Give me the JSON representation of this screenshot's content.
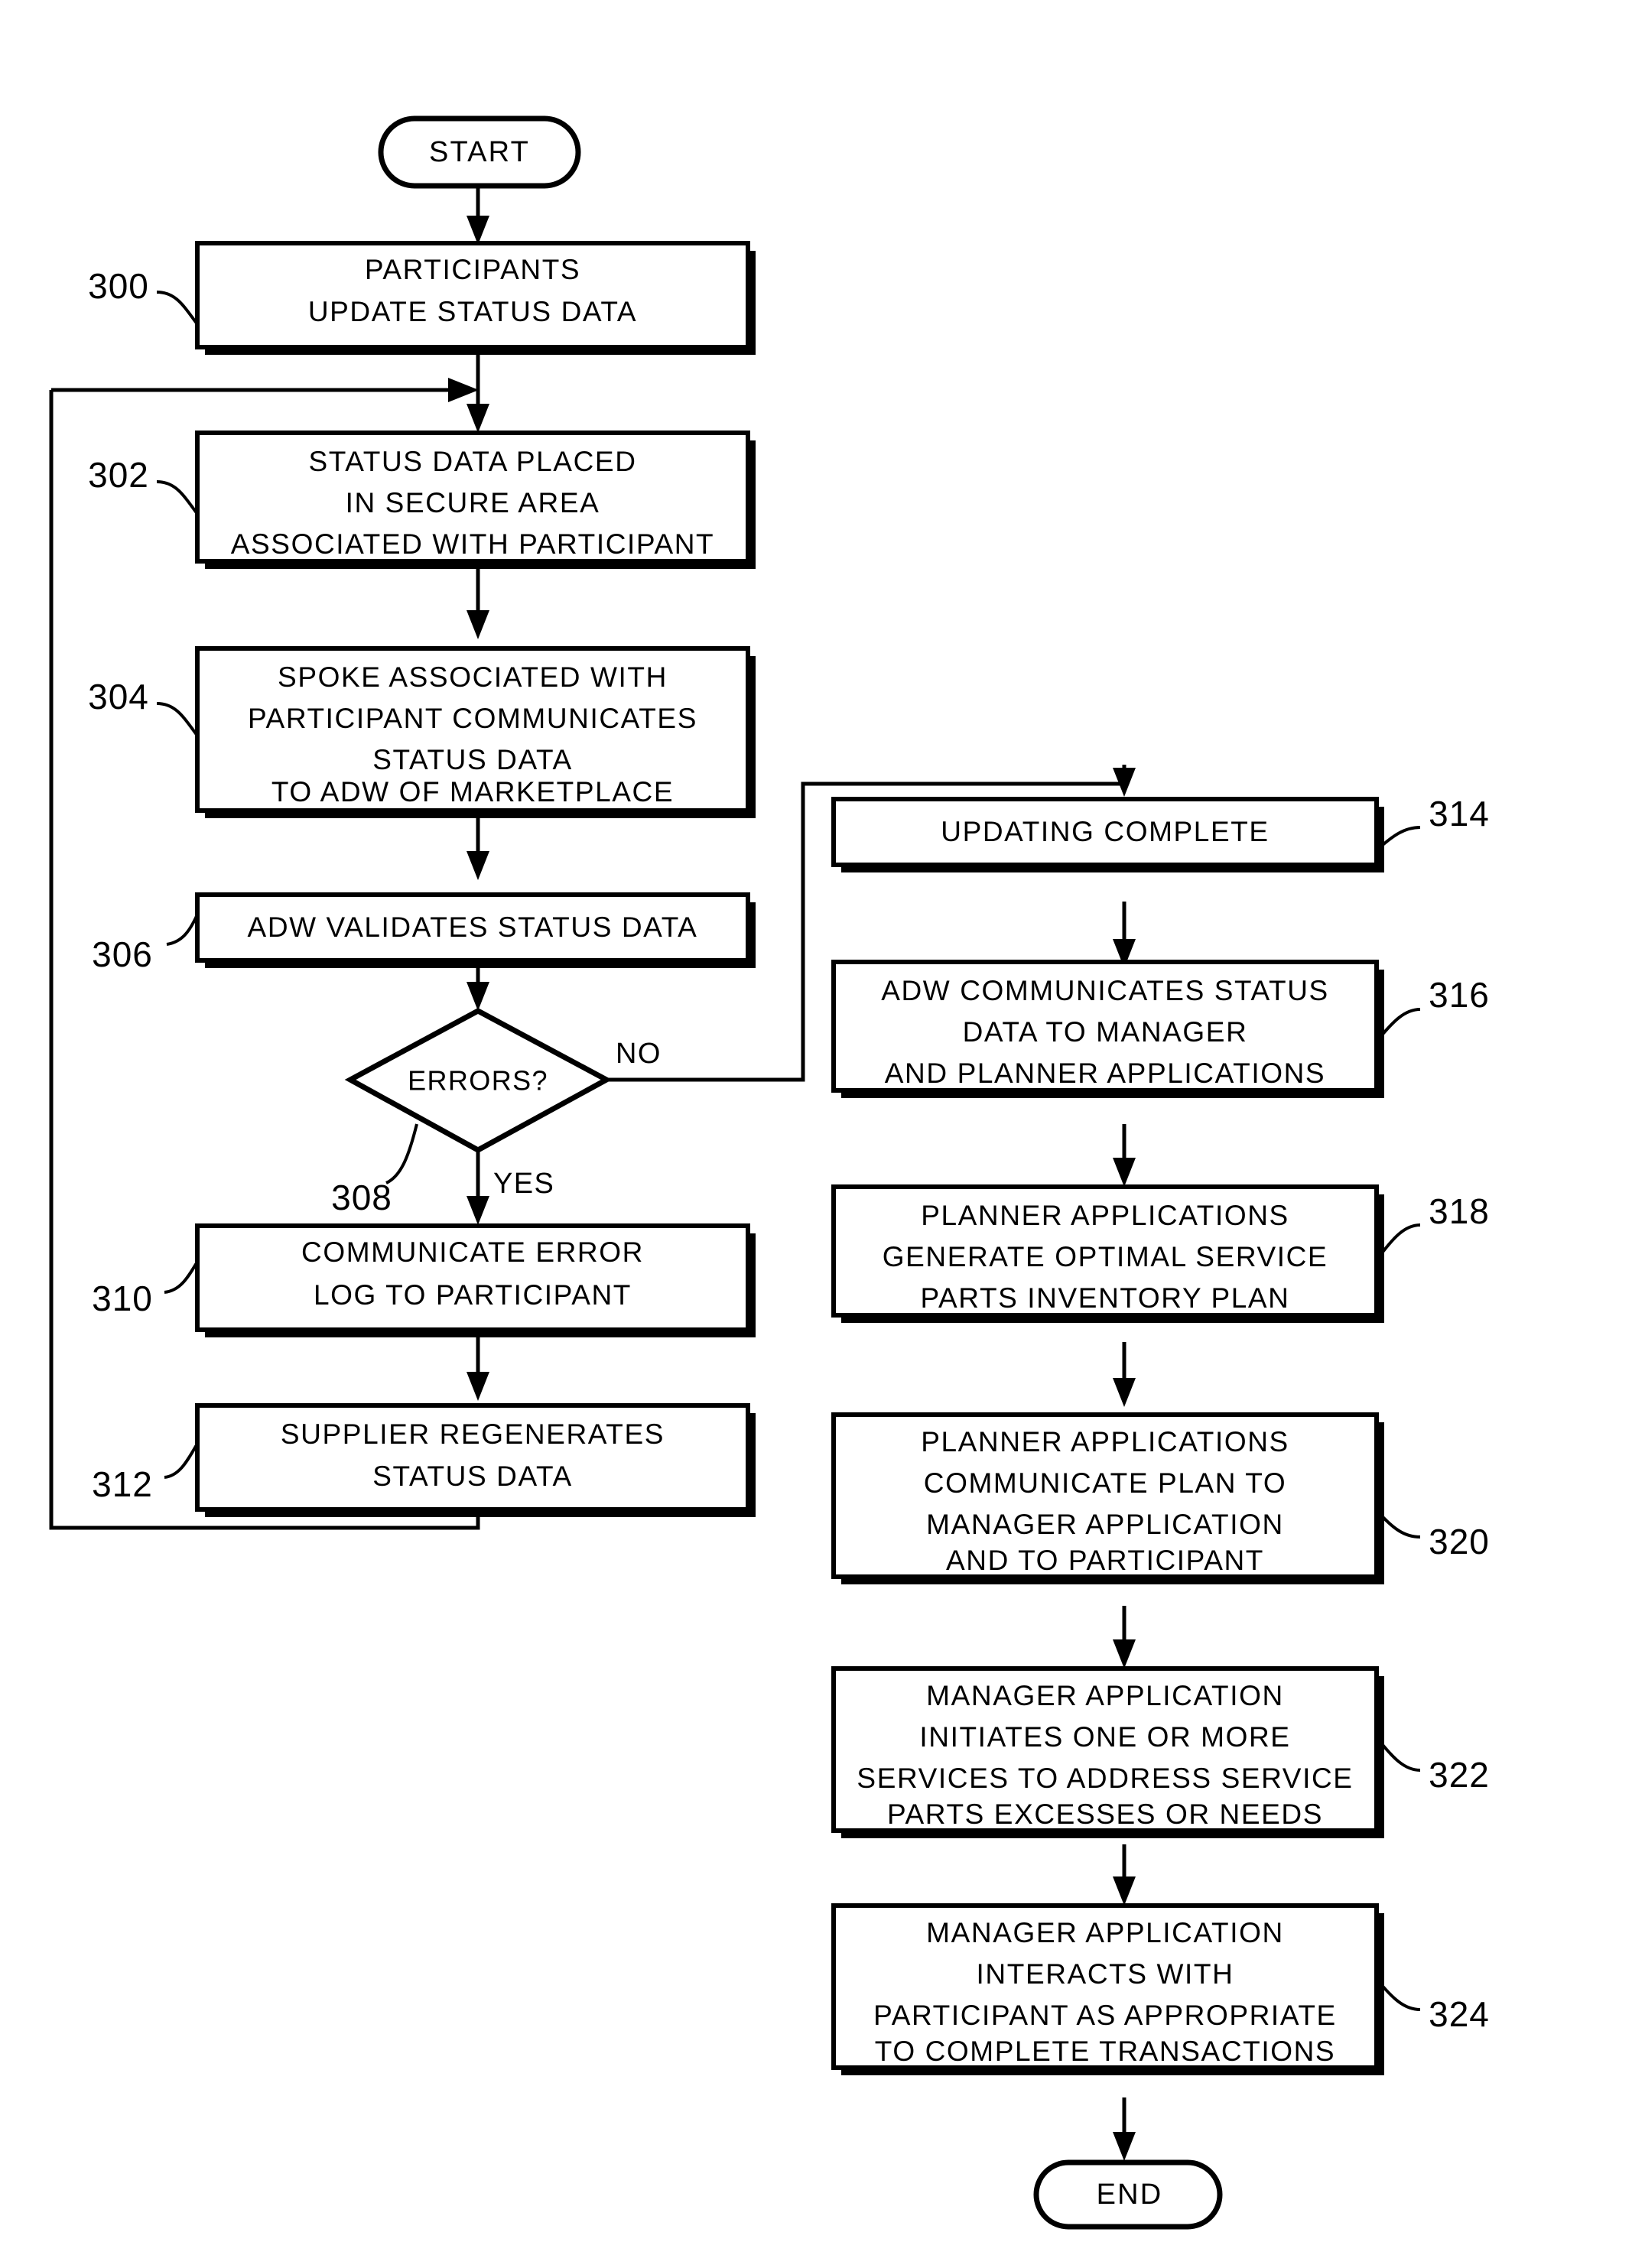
{
  "diagram": {
    "type": "flowchart",
    "terminals": {
      "start": {
        "label": "START",
        "ref": ""
      },
      "end": {
        "label": "END",
        "ref": ""
      }
    },
    "decision": {
      "label": "ERRORS?",
      "ref": "308",
      "branch_no": "NO",
      "branch_yes": "YES"
    },
    "nodes": [
      {
        "ref": "300",
        "lines": [
          "PARTICIPANTS",
          "UPDATE STATUS DATA"
        ]
      },
      {
        "ref": "302",
        "lines": [
          "STATUS DATA PLACED",
          "IN SECURE AREA",
          "ASSOCIATED WITH PARTICIPANT"
        ]
      },
      {
        "ref": "304",
        "lines": [
          "SPOKE ASSOCIATED WITH",
          "PARTICIPANT COMMUNICATES",
          "STATUS DATA",
          "TO ADW OF MARKETPLACE"
        ]
      },
      {
        "ref": "306",
        "lines": [
          "ADW VALIDATES STATUS DATA"
        ]
      },
      {
        "ref": "310",
        "lines": [
          "COMMUNICATE ERROR",
          "LOG TO PARTICIPANT"
        ]
      },
      {
        "ref": "312",
        "lines": [
          "SUPPLIER REGENERATES",
          "STATUS DATA"
        ]
      },
      {
        "ref": "314",
        "lines": [
          "UPDATING COMPLETE"
        ]
      },
      {
        "ref": "316",
        "lines": [
          "ADW COMMUNICATES STATUS",
          "DATA TO MANAGER",
          "AND PLANNER APPLICATIONS"
        ]
      },
      {
        "ref": "318",
        "lines": [
          "PLANNER APPLICATIONS",
          "GENERATE OPTIMAL SERVICE",
          "PARTS INVENTORY PLAN"
        ]
      },
      {
        "ref": "320",
        "lines": [
          "PLANNER APPLICATIONS",
          "COMMUNICATE PLAN TO",
          "MANAGER APPLICATION",
          "AND TO PARTICIPANT"
        ]
      },
      {
        "ref": "322",
        "lines": [
          "MANAGER APPLICATION",
          "INITIATES ONE OR MORE",
          "SERVICES TO ADDRESS SERVICE",
          "PARTS EXCESSES OR NEEDS"
        ]
      },
      {
        "ref": "324",
        "lines": [
          "MANAGER APPLICATION",
          "INTERACTS WITH",
          "PARTICIPANT AS APPROPRIATE",
          "TO COMPLETE TRANSACTIONS"
        ]
      }
    ],
    "colors": {
      "ink": "#000000",
      "paper": "#ffffff"
    }
  }
}
